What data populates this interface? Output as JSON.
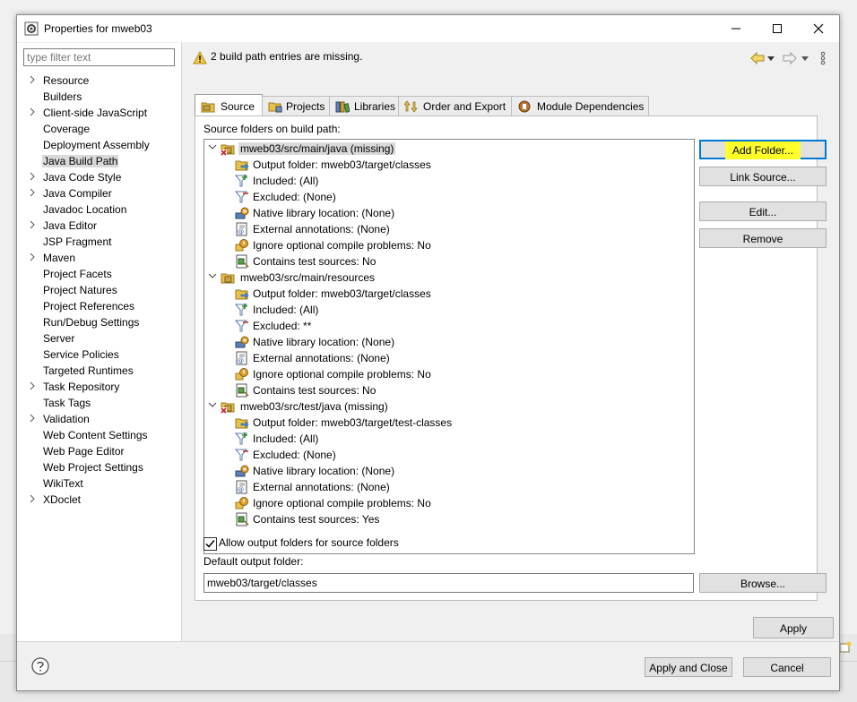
{
  "window": {
    "title": "Properties for mweb03"
  },
  "filter": {
    "placeholder": "type filter text"
  },
  "nav_items": [
    {
      "label": "Resource",
      "expandable": true
    },
    {
      "label": "Builders",
      "expandable": false
    },
    {
      "label": "Client-side JavaScript",
      "expandable": true
    },
    {
      "label": "Coverage",
      "expandable": false
    },
    {
      "label": "Deployment Assembly",
      "expandable": false
    },
    {
      "label": "Java Build Path",
      "expandable": false,
      "selected": true
    },
    {
      "label": "Java Code Style",
      "expandable": true
    },
    {
      "label": "Java Compiler",
      "expandable": true
    },
    {
      "label": "Javadoc Location",
      "expandable": false
    },
    {
      "label": "Java Editor",
      "expandable": true
    },
    {
      "label": "JSP Fragment",
      "expandable": false
    },
    {
      "label": "Maven",
      "expandable": true
    },
    {
      "label": "Project Facets",
      "expandable": false
    },
    {
      "label": "Project Natures",
      "expandable": false
    },
    {
      "label": "Project References",
      "expandable": false
    },
    {
      "label": "Run/Debug Settings",
      "expandable": false
    },
    {
      "label": "Server",
      "expandable": false
    },
    {
      "label": "Service Policies",
      "expandable": false
    },
    {
      "label": "Targeted Runtimes",
      "expandable": false
    },
    {
      "label": "Task Repository",
      "expandable": true
    },
    {
      "label": "Task Tags",
      "expandable": false
    },
    {
      "label": "Validation",
      "expandable": true
    },
    {
      "label": "Web Content Settings",
      "expandable": false
    },
    {
      "label": "Web Page Editor",
      "expandable": false
    },
    {
      "label": "Web Project Settings",
      "expandable": false
    },
    {
      "label": "WikiText",
      "expandable": false
    },
    {
      "label": "XDoclet",
      "expandable": true
    }
  ],
  "message": {
    "text": "2 build path entries are missing."
  },
  "tabs": [
    {
      "label": "Source",
      "active": true,
      "icon": "source-folder-icon"
    },
    {
      "label": "Projects",
      "icon": "projects-icon"
    },
    {
      "label": "Libraries",
      "icon": "libraries-icon"
    },
    {
      "label": "Order and Export",
      "icon": "order-export-icon"
    },
    {
      "label": "Module Dependencies",
      "icon": "module-icon"
    }
  ],
  "source": {
    "section_label": "Source folders on build path:",
    "folders": [
      {
        "name": "mweb03/src/main/java (missing)",
        "missing": true,
        "selected": true,
        "children": [
          {
            "text": "Output folder: mweb03/target/classes",
            "icon": "output-folder-icon"
          },
          {
            "text": "Included: (All)",
            "icon": "include-filter-icon"
          },
          {
            "text": "Excluded: (None)",
            "icon": "exclude-filter-icon"
          },
          {
            "text": "Native library location: (None)",
            "icon": "native-library-icon"
          },
          {
            "text": "External annotations: (None)",
            "icon": "annotations-icon"
          },
          {
            "text": "Ignore optional compile problems: No",
            "icon": "ignore-problems-icon"
          },
          {
            "text": "Contains test sources: No",
            "icon": "test-sources-icon"
          }
        ]
      },
      {
        "name": "mweb03/src/main/resources",
        "missing": false,
        "children": [
          {
            "text": "Output folder: mweb03/target/classes",
            "icon": "output-folder-icon"
          },
          {
            "text": "Included: (All)",
            "icon": "include-filter-icon"
          },
          {
            "text": "Excluded: **",
            "icon": "exclude-filter-icon"
          },
          {
            "text": "Native library location: (None)",
            "icon": "native-library-icon"
          },
          {
            "text": "External annotations: (None)",
            "icon": "annotations-icon"
          },
          {
            "text": "Ignore optional compile problems: No",
            "icon": "ignore-problems-icon"
          },
          {
            "text": "Contains test sources: No",
            "icon": "test-sources-icon"
          }
        ]
      },
      {
        "name": "mweb03/src/test/java (missing)",
        "missing": true,
        "children": [
          {
            "text": "Output folder: mweb03/target/test-classes",
            "icon": "output-folder-icon"
          },
          {
            "text": "Included: (All)",
            "icon": "include-filter-icon"
          },
          {
            "text": "Excluded: (None)",
            "icon": "exclude-filter-icon"
          },
          {
            "text": "Native library location: (None)",
            "icon": "native-library-icon"
          },
          {
            "text": "External annotations: (None)",
            "icon": "annotations-icon"
          },
          {
            "text": "Ignore optional compile problems: No",
            "icon": "ignore-problems-icon"
          },
          {
            "text": "Contains test sources: Yes",
            "icon": "test-sources-icon"
          }
        ]
      }
    ],
    "buttons": {
      "add_folder": "Add Folder...",
      "link_source": "Link Source...",
      "edit": "Edit...",
      "remove": "Remove"
    },
    "allow_output_label": "Allow output folders for source folders",
    "allow_output_checked": true,
    "default_output_label": "Default output folder:",
    "default_output_value": "mweb03/target/classes",
    "browse": "Browse..."
  },
  "footer": {
    "apply": "Apply",
    "apply_close": "Apply and Close",
    "cancel": "Cancel"
  },
  "colors": {
    "highlight": "#ffff2a",
    "selection": "#d9d9d9",
    "focus_border": "#0078d7"
  }
}
